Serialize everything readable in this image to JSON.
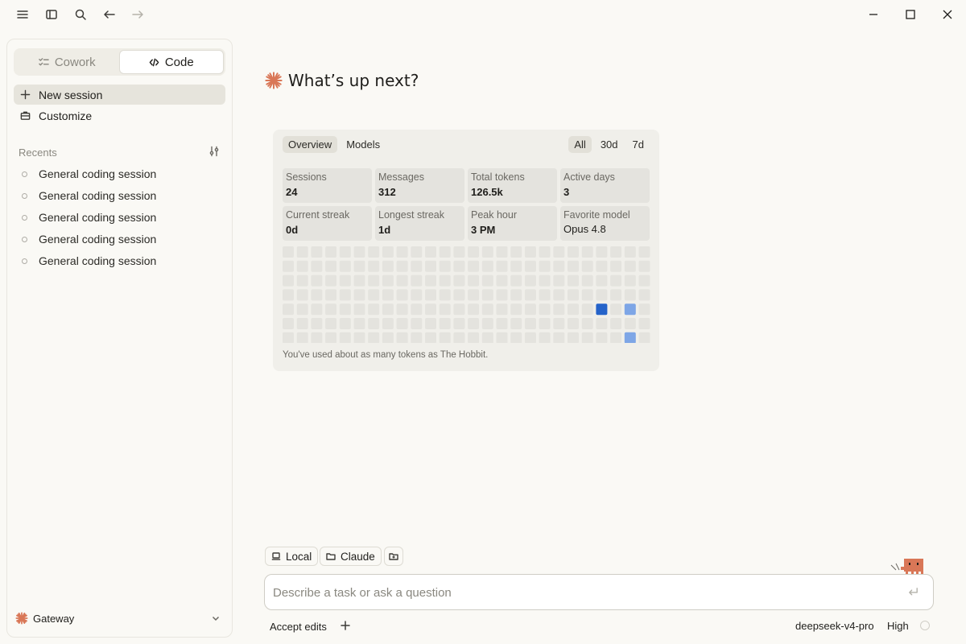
{
  "sidebar": {
    "modes": [
      {
        "label": "Cowork",
        "active": false
      },
      {
        "label": "Code",
        "active": true
      }
    ],
    "new_session_label": "New session",
    "customize_label": "Customize",
    "recents_label": "Recents",
    "recents": [
      "General coding session",
      "General coding session",
      "General coding session",
      "General coding session",
      "General coding session"
    ],
    "gateway_label": "Gateway"
  },
  "main": {
    "heading": "What’s up next?",
    "accent_color": "#d97757",
    "stats": {
      "tabs": [
        "Overview",
        "Models"
      ],
      "active_tab": "Overview",
      "ranges": [
        "All",
        "30d",
        "7d"
      ],
      "active_range": "All",
      "tiles": [
        {
          "label": "Sessions",
          "value": "24"
        },
        {
          "label": "Messages",
          "value": "312"
        },
        {
          "label": "Total tokens",
          "value": "126.5k"
        },
        {
          "label": "Active days",
          "value": "3"
        },
        {
          "label": "Current streak",
          "value": "0d"
        },
        {
          "label": "Longest streak",
          "value": "1d"
        },
        {
          "label": "Peak hour",
          "value": "3 PM"
        },
        {
          "label": "Favorite model",
          "value": "Opus 4.8"
        }
      ],
      "heatmap": {
        "columns": 26,
        "rows": 7,
        "empty_color": "#e4e3de",
        "active_cells": [
          {
            "col": 22,
            "row": 4,
            "level": 3
          },
          {
            "col": 24,
            "row": 4,
            "level": 1
          },
          {
            "col": 24,
            "row": 6,
            "level": 1
          }
        ],
        "level_colors": {
          "1": "#7ea6e6",
          "3": "#2563c9"
        }
      },
      "footer": "You've used about as many tokens as The Hobbit."
    }
  },
  "composer": {
    "chips": [
      "Local",
      "Claude"
    ],
    "placeholder": "Describe a task or ask a question",
    "accept_edits_label": "Accept edits",
    "model": "deepseek-v4-pro",
    "effort": "High"
  }
}
